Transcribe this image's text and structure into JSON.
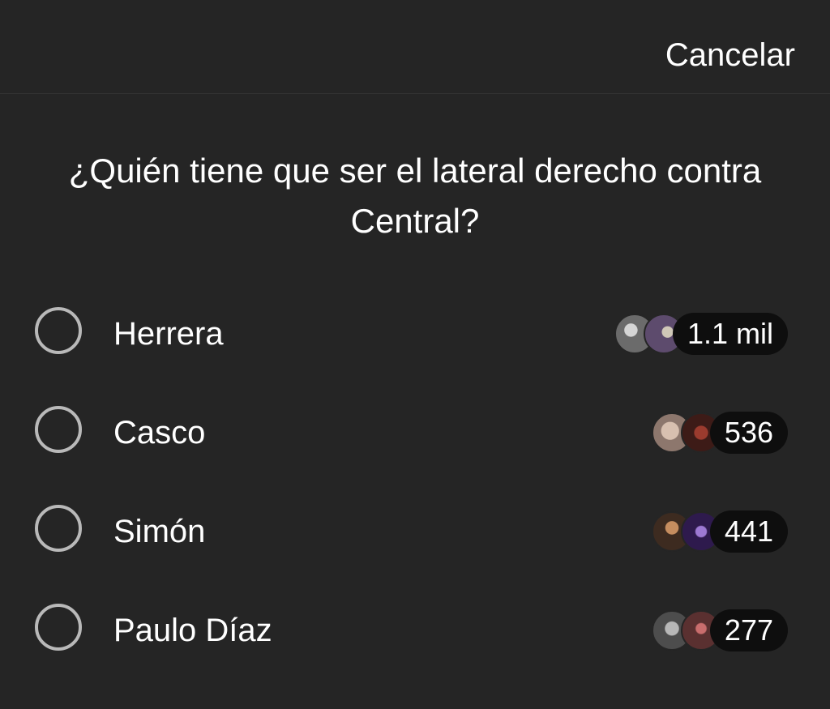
{
  "header": {
    "cancel_label": "Cancelar"
  },
  "poll": {
    "question": "¿Quién tiene que ser el lateral derecho contra Central?",
    "options": [
      {
        "label": "Herrera",
        "votes": "1.1 mil",
        "avatar_colors": [
          "#8d8d8d",
          "#5d4b6d"
        ]
      },
      {
        "label": "Casco",
        "votes": "536",
        "avatar_colors": [
          "#c8b4a5",
          "#5c241d"
        ]
      },
      {
        "label": "Simón",
        "votes": "441",
        "avatar_colors": [
          "#9f7e54",
          "#4d2d7d"
        ]
      },
      {
        "label": "Paulo Díaz",
        "votes": "277",
        "avatar_colors": [
          "#7e7e7e",
          "#8a4b4b"
        ]
      }
    ]
  },
  "colors": {
    "background": "#252525",
    "radio_border": "#b9b9b9",
    "pill_background": "#0e0e0e",
    "text": "#ffffff"
  }
}
